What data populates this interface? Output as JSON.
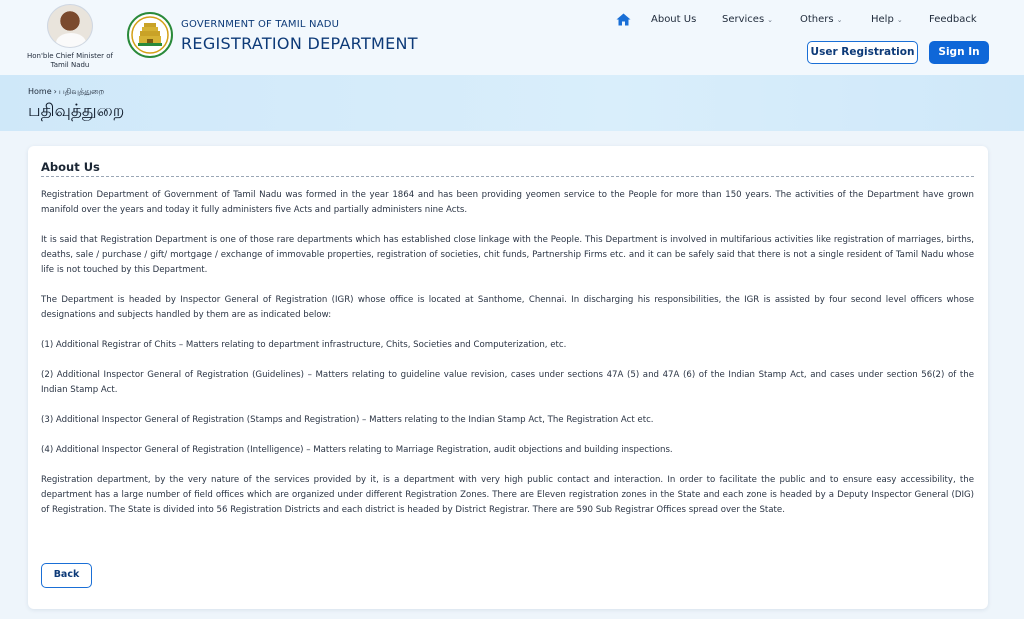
{
  "header": {
    "cm_caption": "Hon'ble Chief Minister of Tamil Nadu",
    "gov_name": "GOVERNMENT OF TAMIL NADU",
    "dept_name": "REGISTRATION DEPARTMENT",
    "home_icon": "home-icon",
    "nav": [
      {
        "label": "About Us",
        "dropdown": false
      },
      {
        "label": "Services",
        "dropdown": true
      },
      {
        "label": "Others",
        "dropdown": true
      },
      {
        "label": "Help",
        "dropdown": true
      },
      {
        "label": "Feedback",
        "dropdown": false
      }
    ],
    "user_registration_label": "User Registration",
    "signin_label": "Sign In"
  },
  "banner": {
    "breadcrumb_home": "Home",
    "breadcrumb_sep": "›",
    "breadcrumb_current": "பதிவுத்துறை",
    "title": "பதிவுத்துறை"
  },
  "content": {
    "heading": "About Us",
    "paragraphs": [
      "Registration Department of Government of Tamil Nadu was formed in the year 1864 and has been providing yeomen service to the People for more than 150 years. The activities of the Department have grown manifold over the years and today it fully administers five Acts and partially administers nine Acts.",
      "It is said that Registration Department is one of those rare departments which has established close linkage with the People.  This Department is involved in multifarious activities like registration of marriages, births, deaths, sale / purchase / gift/ mortgage / exchange of immovable properties, registration of societies, chit funds, Partnership Firms etc. and it can be safely said that there is not a single resident of Tamil Nadu whose life is not touched by this Department.",
      "The Department is headed by Inspector General of Registration (IGR) whose office is located at Santhome, Chennai. In discharging his responsibilities, the IGR is assisted by four second level officers whose designations and subjects handled by them are as indicated below:",
      "(1) Additional Registrar of Chits – Matters relating to department infrastructure, Chits, Societies and   Computerization, etc.",
      "(2) Additional Inspector General of Registration (Guidelines) – Matters relating to guideline value revision, cases under sections 47A (5) and 47A (6) of the Indian Stamp Act, and cases under section 56(2) of the Indian Stamp Act.",
      "(3) Additional Inspector General of Registration (Stamps and Registration) – Matters relating to the Indian Stamp Act, The Registration Act etc.",
      "(4) Additional Inspector General of Registration (Intelligence) – Matters relating to Marriage Registration, audit objections and building inspections.",
      "Registration department, by the very nature of the services provided by it, is a department with very high public contact and interaction. In order to facilitate the public and to ensure easy accessibility, the department has a large number of field offices which are organized under different Registration Zones. There are Eleven registration zones in the State and each zone is headed by a Deputy Inspector General (DIG) of Registration. The State is divided into 56 Registration Districts and each district is headed by District Registrar. There are 590 Sub Registrar Offices spread over the State."
    ],
    "back_label": "Back"
  },
  "colors": {
    "brand_blue": "#0d3a78",
    "accent_blue": "#0f67d8",
    "banner_bg": "#d3ebfa"
  }
}
